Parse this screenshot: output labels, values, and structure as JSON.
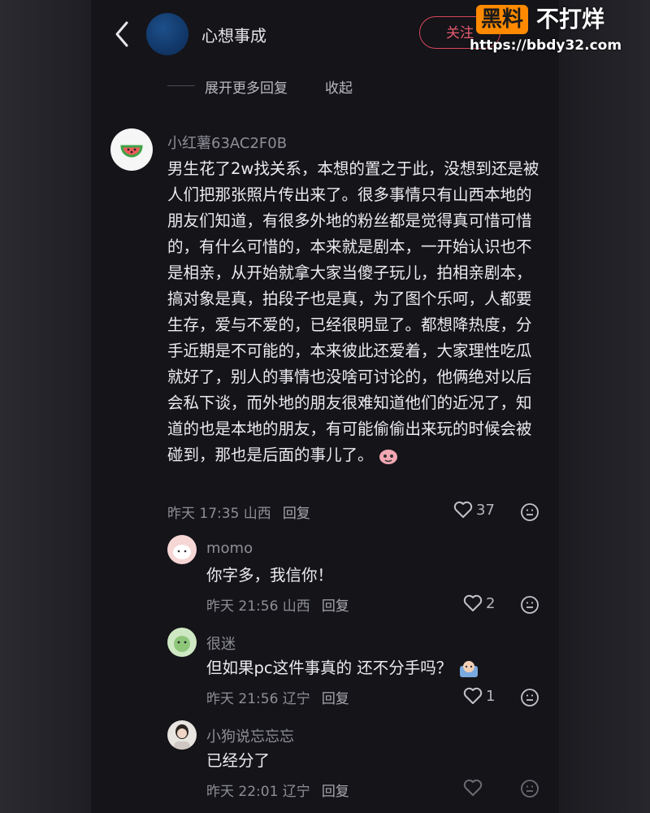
{
  "header": {
    "title": "心想事成",
    "follow_label": "关注"
  },
  "thread": {
    "expand_more": "展开更多回复",
    "collapse": "收起"
  },
  "comment": {
    "author": "小红薯63AC2F0B",
    "text": "男生花了2w找关系，本想的置之于此，没想到还是被人们把那张照片传出来了。很多事情只有山西本地的朋友们知道，有很多外地的粉丝都是觉得真可惜可惜的，有什么可惜的，本来就是剧本，一开始认识也不是相亲，从开始就拿大家当傻子玩儿，拍相亲剧本，搞对象是真，拍段子也是真，为了图个乐呵，人都要生存，爱与不爱的，已经很明显了。都想降热度，分手近期是不可能的，本来彼此还爱着，大家理性吃瓜就好了，别人的事情也没啥可讨论的，他俩绝对以后会私下谈，而外地的朋友很难知道他们的近况了，知道的也是本地的朋友，有可能偷偷出来玩的时候会被碰到，那也是后面的事儿了。",
    "time_location": "昨天 17:35 山西",
    "reply_label": "回复",
    "likes": "37"
  },
  "replies": [
    {
      "author": "momo",
      "text": "你字多，我信你！",
      "time_location": "昨天 21:56 山西",
      "reply_label": "回复",
      "likes": "2"
    },
    {
      "author": "很迷",
      "text": "但如果pc这件事真的 还不分手吗？",
      "time_location": "昨天 21:56 辽宁",
      "reply_label": "回复",
      "likes": "1"
    },
    {
      "author": "小狗说忘忘忘",
      "text": "已经分了",
      "time_location": "昨天 22:01 辽宁",
      "reply_label": "回复",
      "likes": ""
    }
  ],
  "watermark": {
    "logo_text": "黑料",
    "tagline": "不打烊",
    "url": "https://bbdy32.com"
  },
  "colors": {
    "background": "#141419",
    "follow_red": "#d9475b",
    "watermark_orange": "#ff8a00"
  }
}
